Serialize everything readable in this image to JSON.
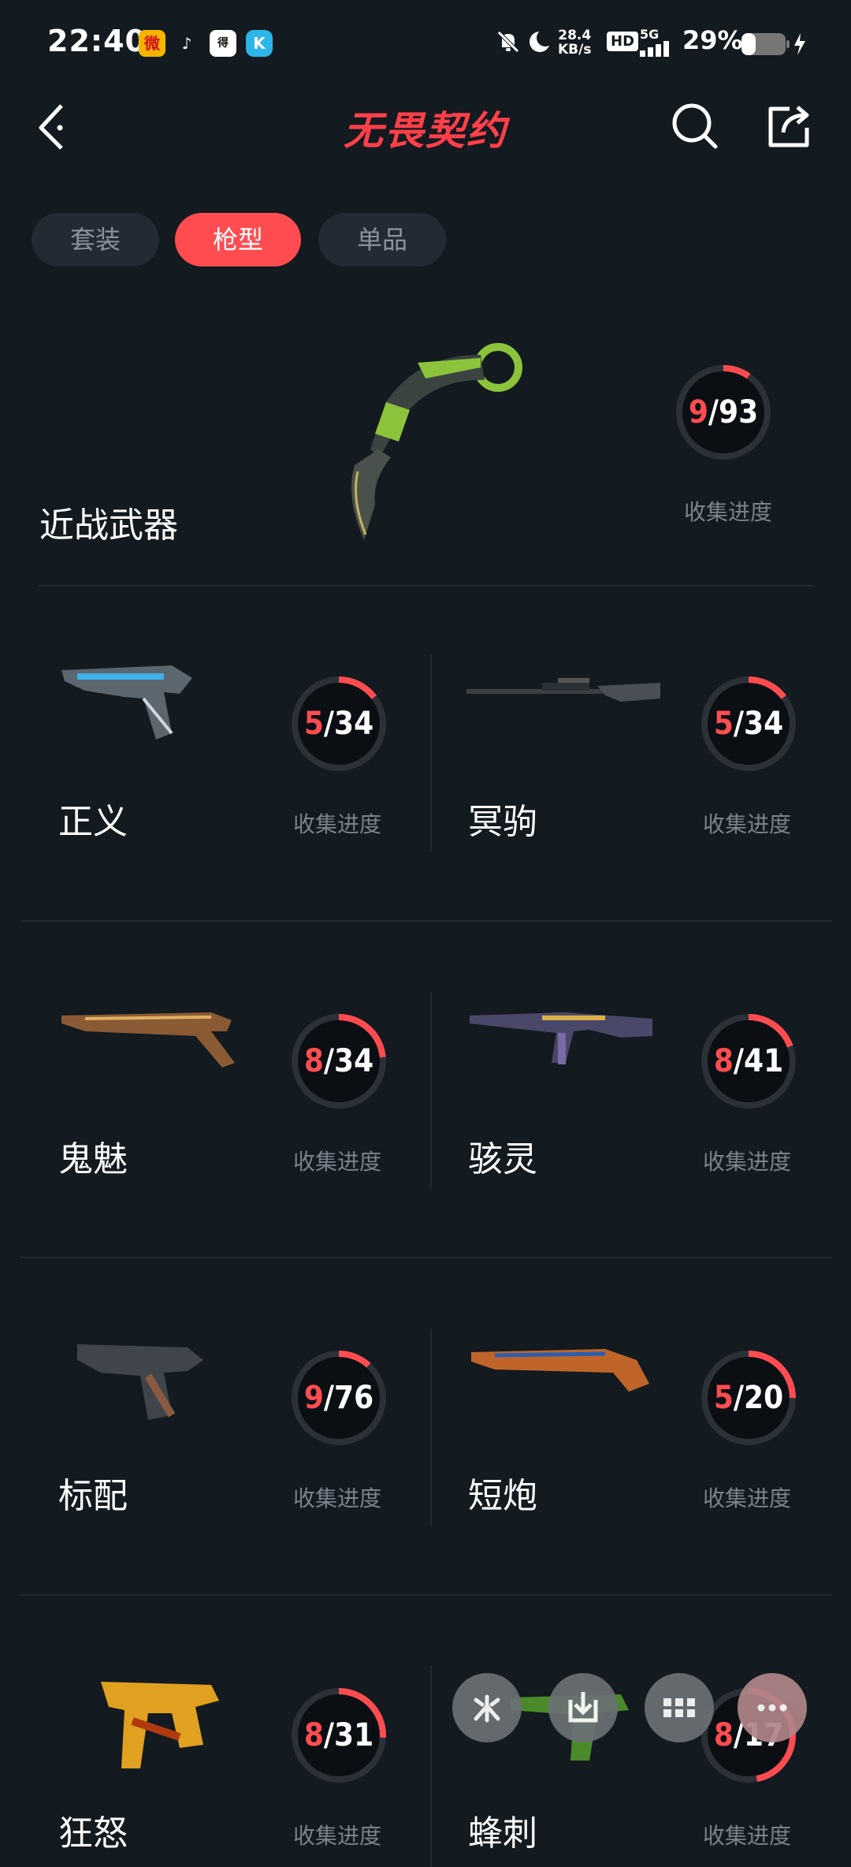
{
  "status_bar": {
    "time": "22:40",
    "net_speed_value": "28.4",
    "net_speed_unit": "KB/s",
    "hd": "HD",
    "signal": "5G",
    "battery": "29%",
    "apps": [
      "weibo-icon",
      "tiktok-icon",
      "app-icon",
      "k-app-icon"
    ]
  },
  "header": {
    "title": "无畏契约"
  },
  "tabs": [
    {
      "label": "套装",
      "active": false
    },
    {
      "label": "枪型",
      "active": true
    },
    {
      "label": "单品",
      "active": false
    }
  ],
  "accent_color": "#ff4c50",
  "progress_label": "收集进度",
  "featured": {
    "name": "近战武器",
    "collected": "9",
    "total": "/93",
    "fraction": 0.097
  },
  "weapons": [
    {
      "name": "正义",
      "collected": "5",
      "total": "/34",
      "fraction": 0.147
    },
    {
      "name": "冥驹",
      "collected": "5",
      "total": "/34",
      "fraction": 0.147
    },
    {
      "name": "鬼魅",
      "collected": "8",
      "total": "/34",
      "fraction": 0.235
    },
    {
      "name": "骇灵",
      "collected": "8",
      "total": "/41",
      "fraction": 0.195
    },
    {
      "name": "标配",
      "collected": "9",
      "total": "/76",
      "fraction": 0.118
    },
    {
      "name": "短炮",
      "collected": "5",
      "total": "/20",
      "fraction": 0.25
    },
    {
      "name": "狂怒",
      "collected": "8",
      "total": "/31",
      "fraction": 0.258
    },
    {
      "name": "蜂刺",
      "collected": "8",
      "total": "/17",
      "fraction": 0.47
    }
  ],
  "floating_bar": [
    "pinwheel-icon",
    "download-icon",
    "grid-icon",
    "more-icon"
  ]
}
